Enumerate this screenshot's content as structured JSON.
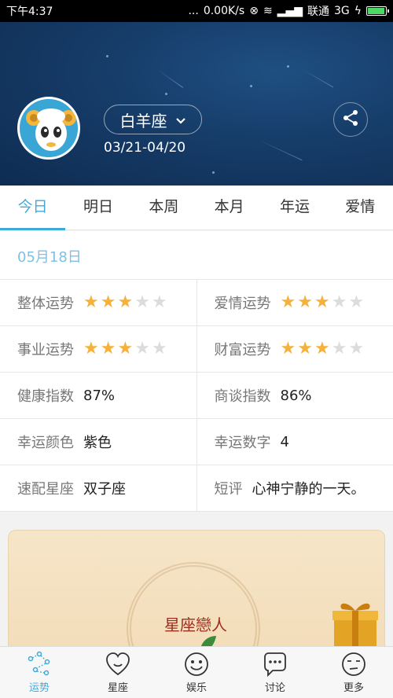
{
  "status_bar": {
    "time": "下午4:37",
    "dots": "...",
    "speed": "0.00K/s",
    "carrier": "联通",
    "network": "3G"
  },
  "header": {
    "sign": "白羊座",
    "date_range": "03/21-04/20"
  },
  "tabs": [
    {
      "label": "今日",
      "active": true
    },
    {
      "label": "明日",
      "active": false
    },
    {
      "label": "本周",
      "active": false
    },
    {
      "label": "本月",
      "active": false
    },
    {
      "label": "年运",
      "active": false
    },
    {
      "label": "爱情",
      "active": false
    }
  ],
  "date_label": "05月18日",
  "fortune": {
    "overall": {
      "label": "整体运势",
      "stars": 3,
      "max": 5
    },
    "love": {
      "label": "爱情运势",
      "stars": 3,
      "max": 5
    },
    "career": {
      "label": "事业运势",
      "stars": 3,
      "max": 5
    },
    "wealth": {
      "label": "财富运势",
      "stars": 3,
      "max": 5
    },
    "health": {
      "label": "健康指数",
      "value": "87%"
    },
    "negotiation": {
      "label": "商谈指数",
      "value": "86%"
    },
    "lucky_color": {
      "label": "幸运颜色",
      "value": "紫色"
    },
    "lucky_number": {
      "label": "幸运数字",
      "value": "4"
    },
    "match_sign": {
      "label": "速配星座",
      "value": "双子座"
    },
    "comment": {
      "label": "短评",
      "value": "心神宁静的一天。"
    }
  },
  "banner": {
    "title": "星座戀人"
  },
  "bottom_nav": [
    {
      "label": "运势",
      "icon": "constellation-icon",
      "active": true
    },
    {
      "label": "星座",
      "icon": "heart-face-icon",
      "active": false
    },
    {
      "label": "娱乐",
      "icon": "smile-face-icon",
      "active": false
    },
    {
      "label": "讨论",
      "icon": "chat-bubble-icon",
      "active": false
    },
    {
      "label": "更多",
      "icon": "more-face-icon",
      "active": false
    }
  ],
  "colors": {
    "accent": "#3fa9d8",
    "star_on": "#f6b13c",
    "star_off": "#dcdcdc",
    "header_bg": "#163c68"
  }
}
